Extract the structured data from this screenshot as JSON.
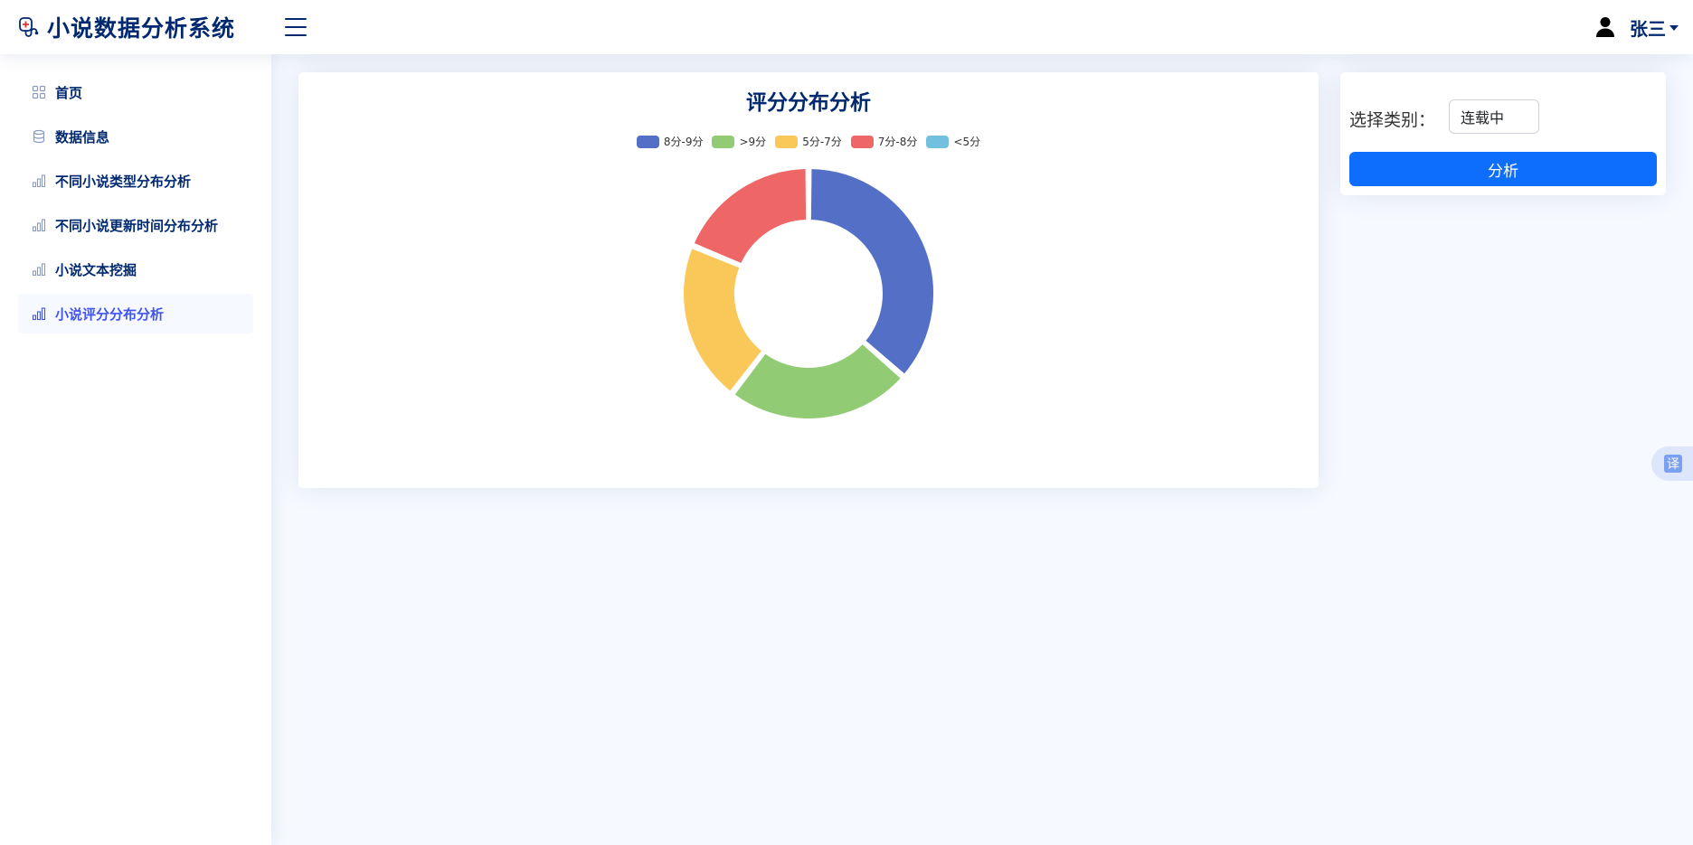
{
  "app": {
    "title": "小说数据分析系统"
  },
  "header": {
    "user_name": "张三"
  },
  "sidebar": {
    "items": [
      {
        "label": "首页",
        "icon": "grid-icon",
        "active": false
      },
      {
        "label": "数据信息",
        "icon": "database-icon",
        "active": false
      },
      {
        "label": "不同小说类型分布分析",
        "icon": "bar-chart-icon",
        "active": false
      },
      {
        "label": "不同小说更新时间分布分析",
        "icon": "bar-chart-icon",
        "active": false
      },
      {
        "label": "小说文本挖掘",
        "icon": "bar-chart-icon",
        "active": false
      },
      {
        "label": "小说评分分布分析",
        "icon": "bar-chart-icon",
        "active": true
      }
    ]
  },
  "filter": {
    "label": "选择类别：",
    "selected": "连载中",
    "button_label": "分析"
  },
  "translate": {
    "label": "译"
  },
  "colors": {
    "accent": "#4154f1",
    "primary_button": "#0d6efd",
    "text": "#012970"
  },
  "chart_data": {
    "type": "pie",
    "variant": "donut",
    "title": "评分分布分析",
    "legend_position": "top-center",
    "series": [
      {
        "name": "8分-9分",
        "value": 35,
        "color": "#5470c6"
      },
      {
        "name": ">9分",
        "value": 23,
        "color": "#91cc75"
      },
      {
        "name": "5分-7分",
        "value": 20,
        "color": "#fac858"
      },
      {
        "name": "7分-8分",
        "value": 18,
        "color": "#ee6666"
      },
      {
        "name": "<5分",
        "value": 0,
        "color": "#73c0de"
      }
    ]
  }
}
